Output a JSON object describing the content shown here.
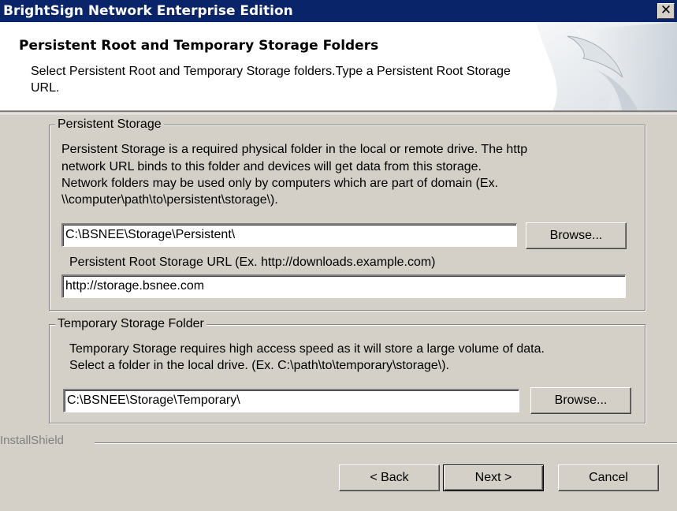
{
  "window": {
    "title": "BrightSign Network Enterprise Edition",
    "close_glyph": "✕"
  },
  "header": {
    "title": "Persistent Root and Temporary Storage Folders",
    "description": "Select Persistent Root and Temporary Storage folders.Type a Persistent Root Storage URL."
  },
  "persistent": {
    "legend": "Persistent Storage",
    "desc_lines": [
      "Persistent Storage is a required physical folder in the local or remote drive.  The http",
      "network URL binds to this folder and devices will get data from this storage.",
      "Network folders may be used only by computers which are part of domain (Ex.",
      "\\\\computer\\path\\to\\persistent\\storage\\)."
    ],
    "folder_value": "C:\\BSNEE\\Storage\\Persistent\\",
    "browse_label": "Browse...",
    "url_label": "Persistent Root Storage URL (Ex. http://downloads.example.com)",
    "url_value": "http://storage.bsnee.com"
  },
  "temporary": {
    "legend": "Temporary Storage Folder",
    "desc_lines": [
      "Temporary Storage requires high access speed as it will store a large volume of data.",
      "Select a folder in the local drive. (Ex. C:\\path\\to\\temporary\\storage\\)."
    ],
    "folder_value": "C:\\BSNEE\\Storage\\Temporary\\",
    "browse_label": "Browse..."
  },
  "footer": {
    "brand": "InstallShield",
    "back_label": "< Back",
    "next_label": "Next >",
    "cancel_label": "Cancel"
  }
}
